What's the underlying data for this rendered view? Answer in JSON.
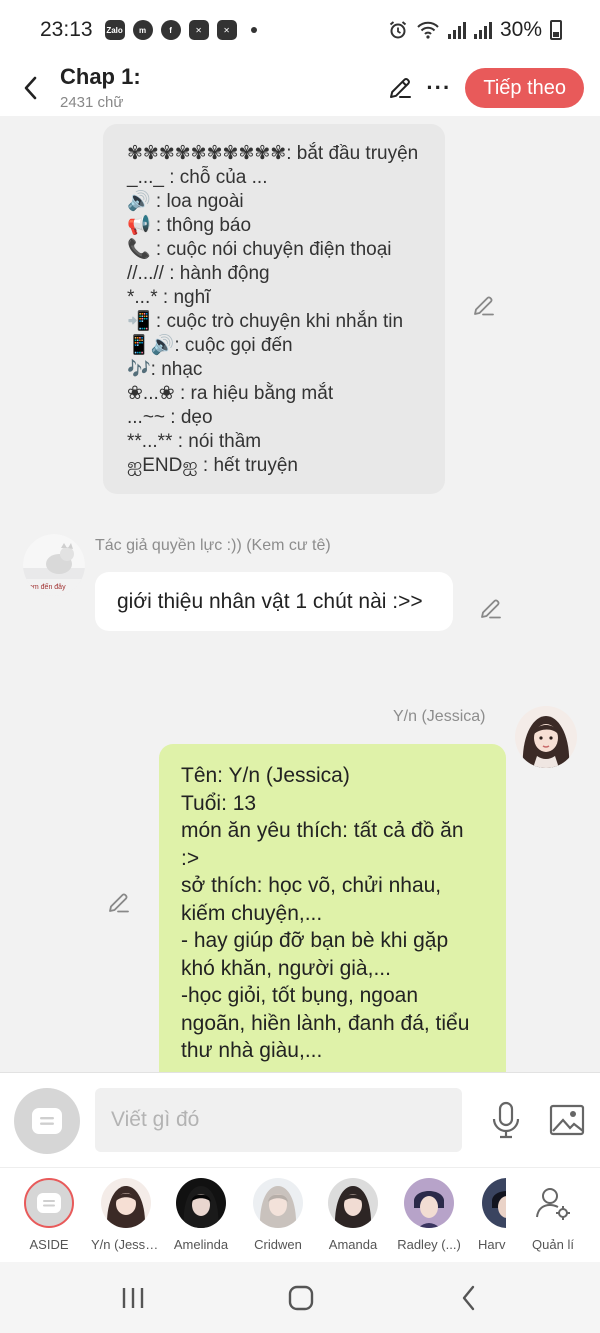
{
  "status_bar": {
    "time": "23:13",
    "notification_icons": [
      "zalo-icon",
      "messenger-icon",
      "facebook-icon",
      "capcut-icon",
      "capcut-icon"
    ],
    "notification_labels": [
      "Zalo",
      "m",
      "f",
      "✕",
      "✕"
    ],
    "battery": "30%"
  },
  "header": {
    "title": "Chap 1:",
    "word_count": "2431 chữ",
    "next_label": "Tiếp theo",
    "more_label": "···"
  },
  "aside_note": {
    "lines": [
      "✾✾✾✾✾✾✾✾✾✾: bắt đầu truyện",
      "_..._ : chỗ của ...",
      "🔊 : loa ngoài",
      "📢 : thông báo",
      "📞 : cuộc nói chuyện điện thoại",
      "//...// : hành động",
      "*...* : nghĩ",
      "📲 : cuộc trò chuyện khi nhắn tin",
      "📱🔊: cuộc gọi đến",
      "🎶: nhạc",
      "❀...❀ : ra hiệu bằng mắt",
      "...~~ : dẹo",
      "**...** : nói thầm",
      "ஐENDஐ : hết truyện"
    ]
  },
  "messages": {
    "author": {
      "name": "Tác giả quyền lực :)) (Kem cư tê)",
      "avatar_caption": "em đến đây",
      "text": "giới thiệu nhân vật 1 chút nài :>>"
    },
    "character": {
      "name": "Y/n (Jessica)",
      "lines": [
        "Tên: Y/n (Jessica)",
        "Tuổi: 13",
        "món ăn yêu thích: tất cả đồ ăn :>",
        "sở thích: học võ, chửi nhau, kiếm chuyện,...",
        "- hay giúp đỡ bạn bè khi gặp khó khăn, người già,...",
        "-học giỏi, tốt bụng, ngoan ngoãn, hiền lành, đanh đá, tiểu thư nhà giàu,..."
      ]
    }
  },
  "input": {
    "placeholder": "Viết gì đó"
  },
  "characters": [
    {
      "label": "ASIDE"
    },
    {
      "label": "Y/n (Jessica)"
    },
    {
      "label": "Amelinda"
    },
    {
      "label": "Cridwen"
    },
    {
      "label": "Amanda"
    },
    {
      "label": "Radley (...)"
    },
    {
      "label": "Harvey"
    },
    {
      "label": "Quản lí"
    }
  ],
  "colors": {
    "accent": "#e85a5a",
    "character_bubble": "#dff2a9",
    "aside_bubble": "#e8e8e8",
    "background": "#f2f2f2"
  }
}
